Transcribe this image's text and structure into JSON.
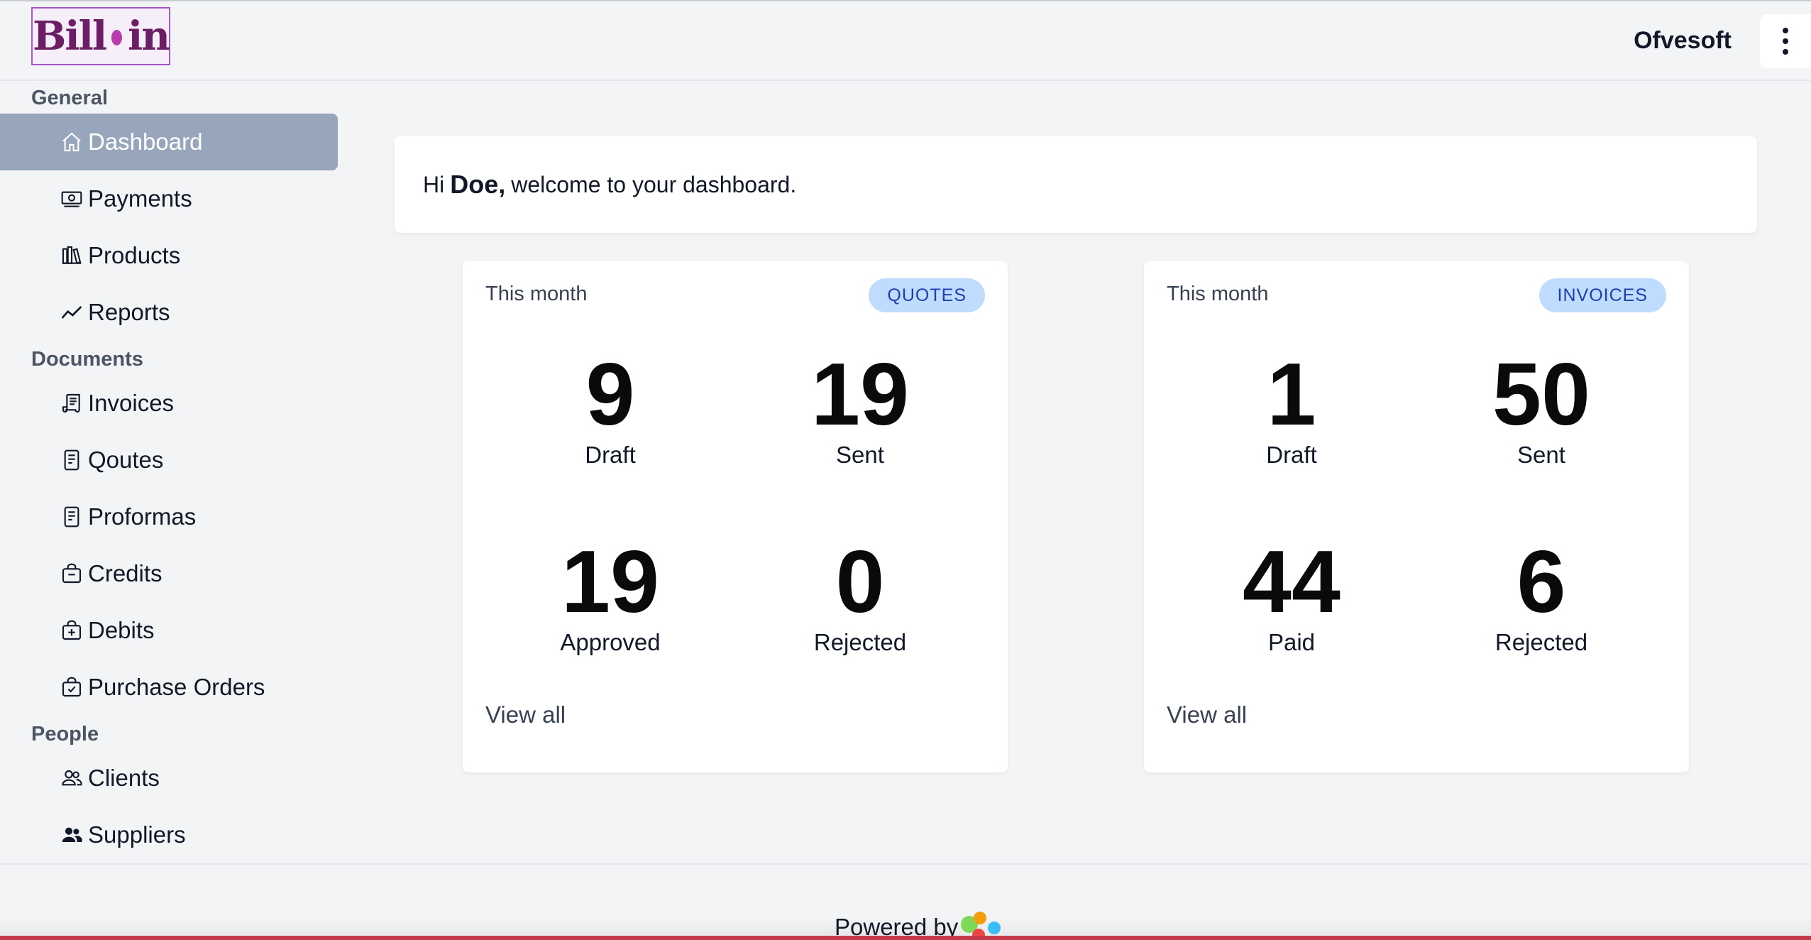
{
  "header": {
    "logo_left": "Bill",
    "logo_right": "in",
    "org_name": "Ofvesoft"
  },
  "sidebar": {
    "sections": [
      {
        "title": "General"
      },
      {
        "title": "Documents"
      },
      {
        "title": "People"
      }
    ],
    "items": [
      {
        "label": "Dashboard",
        "icon": "home-icon",
        "active": true
      },
      {
        "label": "Payments",
        "icon": "cash-icon"
      },
      {
        "label": "Products",
        "icon": "books-icon"
      },
      {
        "label": "Reports",
        "icon": "trend-icon"
      },
      {
        "label": "Invoices",
        "icon": "receipt-icon"
      },
      {
        "label": "Qoutes",
        "icon": "document-icon"
      },
      {
        "label": "Proformas",
        "icon": "document-icon"
      },
      {
        "label": "Credits",
        "icon": "bag-minus-icon"
      },
      {
        "label": "Debits",
        "icon": "bag-plus-icon"
      },
      {
        "label": "Purchase Orders",
        "icon": "bag-check-icon"
      },
      {
        "label": "Clients",
        "icon": "users-outline-icon"
      },
      {
        "label": "Suppliers",
        "icon": "users-solid-icon"
      }
    ]
  },
  "welcome": {
    "greeting": "Hi",
    "name": "Doe,",
    "message": "welcome to your dashboard."
  },
  "cards": [
    {
      "period": "This month",
      "badge": "QUOTES",
      "stats": [
        {
          "value": "9",
          "label": "Draft"
        },
        {
          "value": "19",
          "label": "Sent"
        },
        {
          "value": "19",
          "label": "Approved"
        },
        {
          "value": "0",
          "label": "Rejected"
        }
      ],
      "link": "View all"
    },
    {
      "period": "This month",
      "badge": "INVOICES",
      "stats": [
        {
          "value": "1",
          "label": "Draft"
        },
        {
          "value": "50",
          "label": "Sent"
        },
        {
          "value": "44",
          "label": "Paid"
        },
        {
          "value": "6",
          "label": "Rejected"
        }
      ],
      "link": "View all"
    }
  ],
  "footer": {
    "powered_by": "Powered by"
  },
  "colors": {
    "active_nav": "#97a6ba",
    "badge_bg": "#bfdbfe",
    "badge_text": "#1e40af",
    "logo_accent": "#b93dac"
  }
}
